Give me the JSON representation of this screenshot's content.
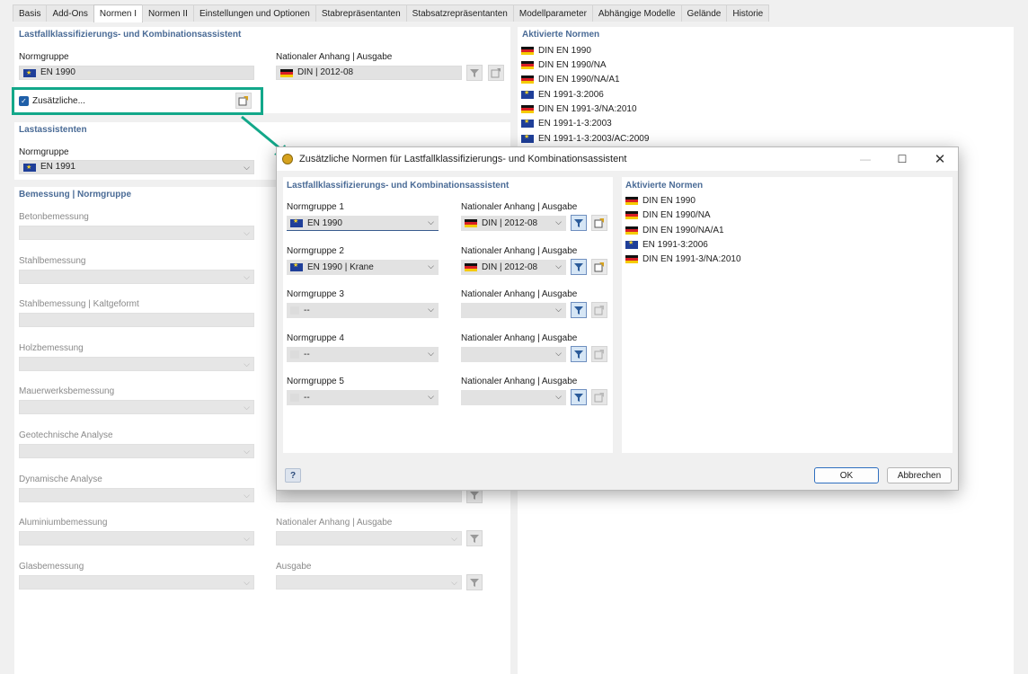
{
  "tabs": [
    "Basis",
    "Add-Ons",
    "Normen I",
    "Normen II",
    "Einstellungen und Optionen",
    "Stabrepräsentanten",
    "Stabsatzrepräsentanten",
    "Modellparameter",
    "Abhängige Modelle",
    "Gelände",
    "Historie"
  ],
  "left": {
    "lastfall": {
      "title": "Lastfallklassifizierungs- und Kombinationsassistent",
      "normgruppe_label": "Normgruppe",
      "normgruppe_value": "EN 1990",
      "national_label": "Nationaler Anhang | Ausgabe",
      "national_value": "DIN | 2012-08",
      "additional_label": "Zusätzliche..."
    },
    "lastassistenten": {
      "title": "Lastassistenten",
      "normgruppe_label": "Normgruppe",
      "normgruppe_value": "EN 1991"
    },
    "bemessung": {
      "title": "Bemessung | Normgruppe",
      "items": [
        "Betonbemessung",
        "Stahlbemessung",
        "Stahlbemessung | Kaltgeformt",
        "Holzbemessung",
        "Mauerwerksbemessung",
        "Geotechnische Analyse",
        "Dynamische Analyse",
        "Aluminiumbemessung",
        "Glasbemessung"
      ],
      "alu_right_label": "Nationaler Anhang | Ausgabe",
      "glas_right_label": "Ausgabe"
    }
  },
  "right": {
    "title": "Aktivierte Normen",
    "items": [
      {
        "flag": "de",
        "text": "DIN EN 1990"
      },
      {
        "flag": "de",
        "text": "DIN EN 1990/NA"
      },
      {
        "flag": "de",
        "text": "DIN EN 1990/NA/A1"
      },
      {
        "flag": "eu",
        "text": "EN 1991-3:2006"
      },
      {
        "flag": "de",
        "text": "DIN EN 1991-3/NA:2010"
      },
      {
        "flag": "eu",
        "text": "EN 1991-1-3:2003"
      },
      {
        "flag": "eu",
        "text": "EN 1991-1-3:2003/AC:2009"
      }
    ]
  },
  "dialog": {
    "title": "Zusätzliche Normen für Lastfallklassifizierungs- und Kombinationsassistent",
    "left_title": "Lastfallklassifizierungs- und Kombinationsassistent",
    "rows": [
      {
        "label": "Normgruppe 1",
        "value": "EN 1990",
        "flag": "eu",
        "nat_label": "Nationaler Anhang | Ausgabe",
        "nat_value": "DIN | 2012-08",
        "nat_flag": "de"
      },
      {
        "label": "Normgruppe 2",
        "value": "EN 1990 | Krane",
        "flag": "eu",
        "nat_label": "Nationaler Anhang | Ausgabe",
        "nat_value": "DIN | 2012-08",
        "nat_flag": "de"
      },
      {
        "label": "Normgruppe 3",
        "value": "--",
        "flag": "none",
        "nat_label": "Nationaler Anhang | Ausgabe",
        "nat_value": "",
        "nat_flag": ""
      },
      {
        "label": "Normgruppe 4",
        "value": "--",
        "flag": "none",
        "nat_label": "Nationaler Anhang | Ausgabe",
        "nat_value": "",
        "nat_flag": ""
      },
      {
        "label": "Normgruppe 5",
        "value": "--",
        "flag": "none",
        "nat_label": "Nationaler Anhang | Ausgabe",
        "nat_value": "",
        "nat_flag": ""
      }
    ],
    "right_title": "Aktivierte Normen",
    "right_items": [
      {
        "flag": "de",
        "text": "DIN EN 1990"
      },
      {
        "flag": "de",
        "text": "DIN EN 1990/NA"
      },
      {
        "flag": "de",
        "text": "DIN EN 1990/NA/A1"
      },
      {
        "flag": "eu",
        "text": "EN 1991-3:2006"
      },
      {
        "flag": "de",
        "text": "DIN EN 1991-3/NA:2010"
      }
    ],
    "ok_label": "OK",
    "cancel_label": "Abbrechen",
    "help_label": "?"
  },
  "colors": {
    "section_title": "#4a6b96",
    "highlight": "#13a88a",
    "checkbox": "#1f5fa8"
  }
}
